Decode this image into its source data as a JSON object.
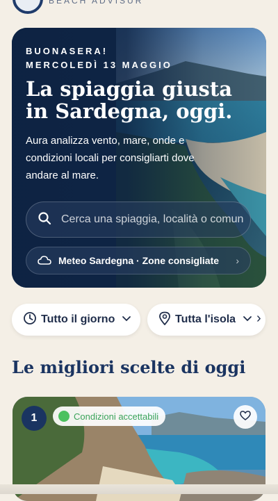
{
  "header": {
    "brand": "BEACH ADVISUR"
  },
  "hero": {
    "greeting": "BUONASERA!",
    "date": "MERCOLEDÌ 13 MAGGIO",
    "title_line1": "La spiaggia giusta",
    "title_line2": "in Sardegna, oggi.",
    "description": "Aura analizza vento, mare, onde e condizioni locali per consigliarti dove andare al mare.",
    "search_placeholder": "Cerca una spiaggia, località o comun",
    "meteo_label": "Meteo Sardegna · Zone consigliate"
  },
  "filters": {
    "time_label": "Tutto il giorno",
    "area_label": "Tutta l'isola"
  },
  "section": {
    "title": "Le migliori scelte di oggi"
  },
  "card": {
    "rank": "1",
    "condition": "Condizioni accettabili",
    "condition_color": "#4cc15f"
  },
  "colors": {
    "background": "#f4efe6",
    "navy": "#1a3461",
    "hero_bg": "#0f2748"
  },
  "icons": {
    "search": "search-icon",
    "cloud": "cloud-icon",
    "clock": "clock-icon",
    "location": "location-pin-icon",
    "heart": "heart-icon"
  }
}
